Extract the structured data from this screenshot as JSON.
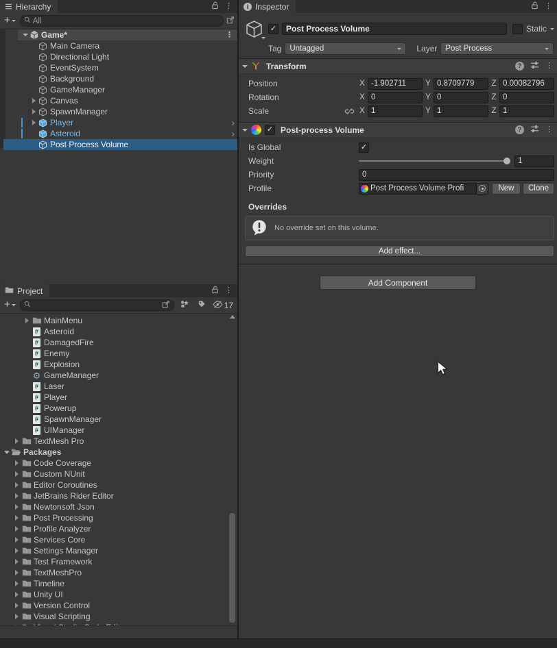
{
  "colors": {
    "selection_blue": "#2C5D87",
    "prefab_blue": "#79BDEA",
    "panel_bg": "#383838"
  },
  "hierarchy": {
    "tab_label": "Hierarchy",
    "search_text": "All",
    "scene": {
      "name": "Game*"
    },
    "items": [
      {
        "label": "Main Camera"
      },
      {
        "label": "Directional Light"
      },
      {
        "label": "EventSystem"
      },
      {
        "label": "Background"
      },
      {
        "label": "GameManager"
      },
      {
        "label": "Canvas",
        "expandable": true
      },
      {
        "label": "SpawnManager",
        "expandable": true
      },
      {
        "label": "Player",
        "prefab": true,
        "expandable": true,
        "chevron": true
      },
      {
        "label": "Asteroid",
        "prefab": true,
        "chevron": true
      },
      {
        "label": "Post Process Volume",
        "selected": true
      }
    ]
  },
  "project": {
    "tab_label": "Project",
    "search_text": "",
    "hidden_count": "17",
    "items": [
      {
        "label": "MainMenu",
        "kind": "folder",
        "depth": 2,
        "arrow": "collapsed"
      },
      {
        "label": "Asteroid",
        "kind": "script",
        "depth": 2
      },
      {
        "label": "DamagedFire",
        "kind": "script",
        "depth": 2
      },
      {
        "label": "Enemy",
        "kind": "script",
        "depth": 2
      },
      {
        "label": "Explosion",
        "kind": "script",
        "depth": 2
      },
      {
        "label": "GameManager",
        "kind": "gear",
        "depth": 2
      },
      {
        "label": "Laser",
        "kind": "script",
        "depth": 2
      },
      {
        "label": "Player",
        "kind": "script",
        "depth": 2
      },
      {
        "label": "Powerup",
        "kind": "script",
        "depth": 2
      },
      {
        "label": "SpawnManager",
        "kind": "script",
        "depth": 2
      },
      {
        "label": "UIManager",
        "kind": "script",
        "depth": 2
      },
      {
        "label": "TextMesh Pro",
        "kind": "folder",
        "depth": 1,
        "arrow": "collapsed"
      },
      {
        "label": "Packages",
        "kind": "folder-open",
        "depth": 0,
        "arrow": "expanded",
        "bold": true
      },
      {
        "label": "Code Coverage",
        "kind": "folder",
        "depth": 1,
        "arrow": "collapsed"
      },
      {
        "label": "Custom NUnit",
        "kind": "folder",
        "depth": 1,
        "arrow": "collapsed"
      },
      {
        "label": "Editor Coroutines",
        "kind": "folder",
        "depth": 1,
        "arrow": "collapsed"
      },
      {
        "label": "JetBrains Rider Editor",
        "kind": "folder",
        "depth": 1,
        "arrow": "collapsed"
      },
      {
        "label": "Newtonsoft Json",
        "kind": "folder",
        "depth": 1,
        "arrow": "collapsed"
      },
      {
        "label": "Post Processing",
        "kind": "folder",
        "depth": 1,
        "arrow": "collapsed"
      },
      {
        "label": "Profile Analyzer",
        "kind": "folder",
        "depth": 1,
        "arrow": "collapsed"
      },
      {
        "label": "Services Core",
        "kind": "folder",
        "depth": 1,
        "arrow": "collapsed"
      },
      {
        "label": "Settings Manager",
        "kind": "folder",
        "depth": 1,
        "arrow": "collapsed"
      },
      {
        "label": "Test Framework",
        "kind": "folder",
        "depth": 1,
        "arrow": "collapsed"
      },
      {
        "label": "TextMeshPro",
        "kind": "folder",
        "depth": 1,
        "arrow": "collapsed"
      },
      {
        "label": "Timeline",
        "kind": "folder",
        "depth": 1,
        "arrow": "collapsed"
      },
      {
        "label": "Unity UI",
        "kind": "folder",
        "depth": 1,
        "arrow": "collapsed"
      },
      {
        "label": "Version Control",
        "kind": "folder",
        "depth": 1,
        "arrow": "collapsed"
      },
      {
        "label": "Visual Scripting",
        "kind": "folder",
        "depth": 1,
        "arrow": "collapsed"
      },
      {
        "label": "Visual Studio Code Editor",
        "kind": "folder",
        "depth": 1,
        "arrow": "collapsed"
      }
    ]
  },
  "inspector": {
    "tab_label": "Inspector",
    "gameobject": {
      "active": true,
      "name": "Post Process Volume",
      "static_label": "Static",
      "tag_label": "Tag",
      "tag_value": "Untagged",
      "layer_label": "Layer",
      "layer_value": "Post Process"
    },
    "transform": {
      "title": "Transform",
      "rows": [
        {
          "label": "Position",
          "axes": [
            {
              "a": "X",
              "v": "-1.902711"
            },
            {
              "a": "Y",
              "v": "0.8709779"
            },
            {
              "a": "Z",
              "v": "0.00082796"
            }
          ]
        },
        {
          "label": "Rotation",
          "axes": [
            {
              "a": "X",
              "v": "0"
            },
            {
              "a": "Y",
              "v": "0"
            },
            {
              "a": "Z",
              "v": "0"
            }
          ]
        },
        {
          "label": "Scale",
          "link_icon": true,
          "axes": [
            {
              "a": "X",
              "v": "1"
            },
            {
              "a": "Y",
              "v": "1"
            },
            {
              "a": "Z",
              "v": "1"
            }
          ]
        }
      ]
    },
    "post_process_volume": {
      "title": "Post-process Volume",
      "enabled": true,
      "fields": {
        "is_global_label": "Is Global",
        "is_global_checked": true,
        "weight_label": "Weight",
        "weight_value": "1",
        "priority_label": "Priority",
        "priority_value": "0",
        "profile_label": "Profile",
        "profile_value": "Post Process Volume Profi",
        "new_button": "New",
        "clone_button": "Clone"
      },
      "overrides_label": "Overrides",
      "override_message": "No override set on this volume.",
      "add_effect_button": "Add effect..."
    },
    "add_component_button": "Add Component"
  }
}
